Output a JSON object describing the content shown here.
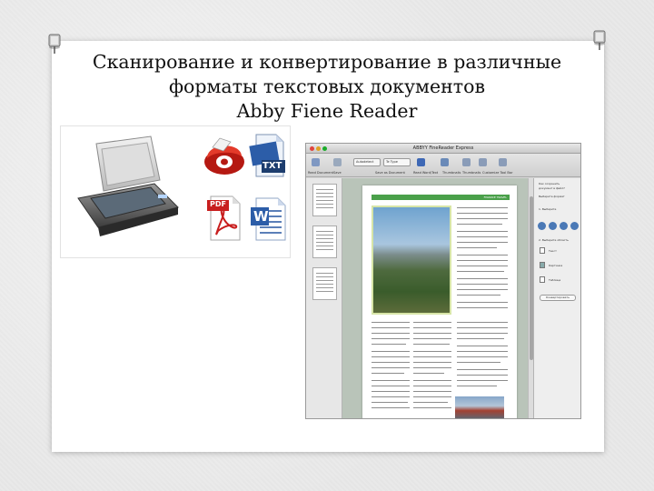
{
  "slide": {
    "title_lines": [
      "Сканирование и конвертирование в различные",
      "форматы текстовых документов",
      "Abby Fiene Reader"
    ]
  },
  "icons": {
    "scanner": "scanner-icon",
    "finereader": "finereader-icon",
    "txt": "txt-file-icon",
    "txt_label": "TXT",
    "pdf": "pdf-file-icon",
    "pdf_label": "PDF",
    "word": "word-file-icon",
    "word_label": "W"
  },
  "app_window": {
    "title": "ABBYY FineReader Express",
    "toolbar": {
      "language_select": "Autodetect",
      "mode_select": "Te Type",
      "labels": [
        "Read Document",
        "Save",
        "Save as Document",
        "Read Word/Text",
        "Thumbnails",
        "Thumbnails",
        "Customize Tool Bar"
      ]
    },
    "page_header": "FINANCE TRAVEL",
    "right_panel": {
      "lines": [
        "Как сохранить",
        "документ в файл?",
        "Выберите формат",
        "1. Выберите",
        "2. Выберите область",
        "Текст",
        "Картинка",
        "Таблица"
      ],
      "button_label": "Конвертировать"
    }
  },
  "colors": {
    "accent_green": "#4aa04a",
    "finereader_red": "#d4271f",
    "word_blue": "#2c5da8"
  }
}
